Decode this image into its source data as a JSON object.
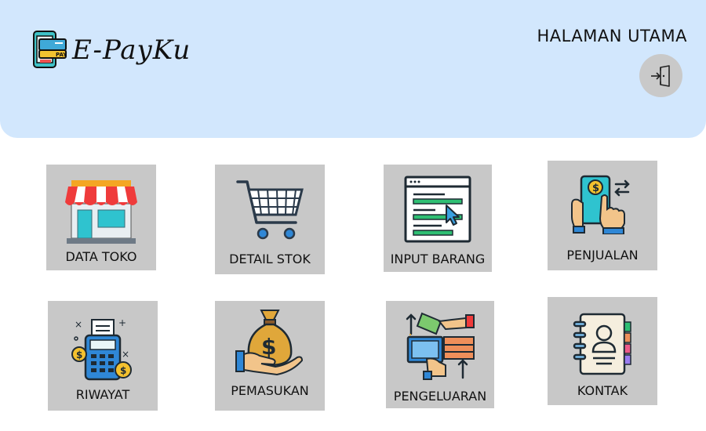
{
  "app": {
    "name": "E-PayKu",
    "logo_icon": "phone-pay-icon"
  },
  "header": {
    "title": "HALAMAN UTAMA",
    "logout_icon": "logout-icon"
  },
  "colors": {
    "header_bg": "#d2e7fd",
    "tile_bg": "#c8c8c8",
    "logout_bg": "#c9c9c9"
  },
  "menu": [
    {
      "label": "DATA TOKO",
      "icon": "store-icon"
    },
    {
      "label": "DETAIL STOK",
      "icon": "shopping-cart-icon"
    },
    {
      "label": "INPUT BARANG",
      "icon": "form-input-icon"
    },
    {
      "label": "PENJUALAN",
      "icon": "mobile-payment-icon"
    },
    {
      "label": "RIWAYAT",
      "icon": "payment-terminal-icon"
    },
    {
      "label": "PEMASUKAN",
      "icon": "money-bag-hand-icon"
    },
    {
      "label": "PENGELUARAN",
      "icon": "payment-exchange-icon"
    },
    {
      "label": "KONTAK",
      "icon": "contact-book-icon"
    }
  ]
}
